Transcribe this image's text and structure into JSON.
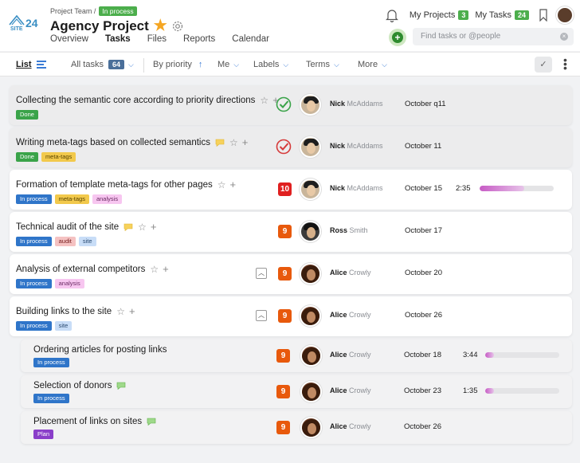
{
  "header": {
    "logo_text": "SITE 24",
    "breadcrumb_parent": "Project Team /",
    "breadcrumb_status": "In process",
    "project_title": "Agency Project",
    "tabs": [
      "Overview",
      "Tasks",
      "Files",
      "Reports",
      "Calendar"
    ],
    "active_tab": "Tasks",
    "my_projects_label": "My Projects",
    "my_projects_count": "3",
    "my_tasks_label": "My Tasks",
    "my_tasks_count": "24",
    "search_placeholder": "Find tasks or @people"
  },
  "toolbar": {
    "list_label": "List",
    "all_tasks_label": "All tasks",
    "all_tasks_count": "64",
    "sort_label": "By priority",
    "me_label": "Me",
    "labels_label": "Labels",
    "terms_label": "Terms",
    "more_label": "More"
  },
  "colors": {
    "accent_green": "#4cae4c",
    "accent_blue": "#2f75c9",
    "priority_orange": "#e8590c",
    "priority_red": "#e02020"
  },
  "tasks": [
    {
      "title": "Collecting the semantic core according to priority directions",
      "tags": [
        "Done"
      ],
      "status_icon": "check-green-icon",
      "first": "Nick",
      "last": "McAddams",
      "date": "October q11"
    },
    {
      "title": "Writing meta-tags based on collected semantics",
      "tags": [
        "Done",
        "meta-tags"
      ],
      "status_icon": "check-red-icon",
      "first": "Nick",
      "last": "McAddams",
      "date": "October 11"
    },
    {
      "title": "Formation of template meta-tags for other pages",
      "tags": [
        "In process",
        "meta-tags",
        "analysis"
      ],
      "priority": "10",
      "first": "Nick",
      "last": "McAddams",
      "date": "October 15",
      "timer": "2:35",
      "progress": 0.6
    },
    {
      "title": "Technical audit of the site",
      "tags": [
        "In process",
        "audit",
        "site"
      ],
      "priority": "9",
      "first": "Ross",
      "last": "Smith",
      "date": "October 17"
    },
    {
      "title": "Analysis of external competitors",
      "tags": [
        "In process",
        "analysis"
      ],
      "priority": "9",
      "first": "Alice",
      "last": "Crowly",
      "date": "October 20"
    },
    {
      "title": "Building links to the site",
      "tags": [
        "In process",
        "site"
      ],
      "priority": "9",
      "first": "Alice",
      "last": "Crowly",
      "date": "October 26"
    },
    {
      "title": "Ordering articles for posting links",
      "tags": [
        "In process"
      ],
      "priority": "9",
      "first": "Alice",
      "last": "Crowly",
      "date": "October 18",
      "timer": "3:44",
      "progress": 0.12
    },
    {
      "title": "Selection of donors",
      "tags": [
        "In process"
      ],
      "priority": "9",
      "first": "Alice",
      "last": "Crowly",
      "date": "October 23",
      "timer": "1:35",
      "progress": 0.12
    },
    {
      "title": "Placement of links on sites",
      "tags": [
        "Plan"
      ],
      "priority": "9",
      "first": "Alice",
      "last": "Crowly",
      "date": "October 26"
    }
  ]
}
